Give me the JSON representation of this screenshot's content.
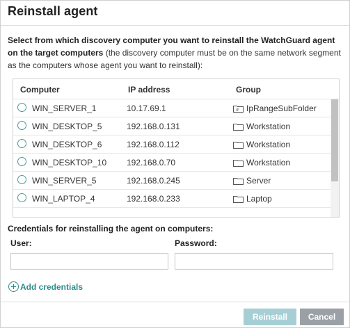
{
  "dialog": {
    "title": "Reinstall agent",
    "intro_bold": "Select from which discovery computer you want to reinstall the WatchGuard agent on the target computers",
    "intro_rest": " (the discovery computer must be on the same network segment as the computers whose agent you want to reinstall):"
  },
  "table": {
    "columns": [
      "Computer",
      "IP address",
      "Group"
    ],
    "rows": [
      {
        "computer": "WIN_SERVER_1",
        "ip": "10.17.69.1",
        "group": "IpRangeSubFolder",
        "icon": "ip-folder-icon"
      },
      {
        "computer": "WIN_DESKTOP_5",
        "ip": "192.168.0.131",
        "group": "Workstation",
        "icon": "folder-icon"
      },
      {
        "computer": "WIN_DESKTOP_6",
        "ip": "192.168.0.112",
        "group": "Workstation",
        "icon": "folder-icon"
      },
      {
        "computer": "WIN_DESKTOP_10",
        "ip": "192.168.0.70",
        "group": "Workstation",
        "icon": "folder-icon"
      },
      {
        "computer": "WIN_SERVER_5",
        "ip": "192.168.0.245",
        "group": "Server",
        "icon": "folder-icon"
      },
      {
        "computer": "WIN_LAPTOP_4",
        "ip": "192.168.0.233",
        "group": "Laptop",
        "icon": "folder-icon"
      }
    ]
  },
  "credentials": {
    "title": "Credentials for reinstalling the agent on computers:",
    "user_label": "User:",
    "user_value": "",
    "password_label": "Password:",
    "password_value": "",
    "add_label": "Add credentials"
  },
  "footer": {
    "reinstall_label": "Reinstall",
    "cancel_label": "Cancel"
  },
  "colors": {
    "accent": "#2f8a8a",
    "reinstall_disabled": "#a6cfd5",
    "cancel": "#9aa0a6"
  }
}
